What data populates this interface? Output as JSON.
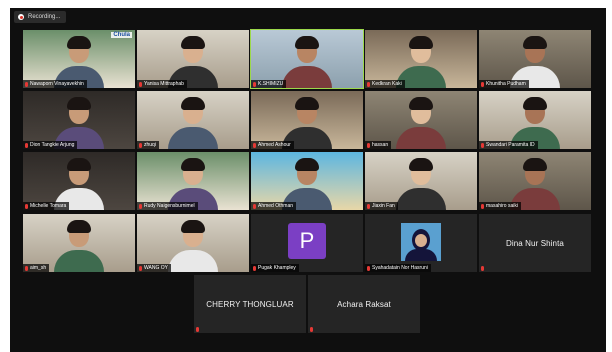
{
  "recording_label": "Recording...",
  "tiles": [
    {
      "id": "t1",
      "name": "Nawaporn Vinayavekhin",
      "style": "room"
    },
    {
      "id": "t2",
      "name": "Yanisa Mittraphab",
      "style": "wall"
    },
    {
      "id": "t3",
      "name": "K.SHIMIZU",
      "style": "office",
      "speaking": true
    },
    {
      "id": "t4",
      "name": "Kedkran Kaki",
      "style": "home"
    },
    {
      "id": "t5",
      "name": "Khunitha Pudham",
      "style": "room2"
    },
    {
      "id": "t6",
      "name": "Dion Tangkie Arjung",
      "style": "dark"
    },
    {
      "id": "t7",
      "name": "zhuqi",
      "style": "wall"
    },
    {
      "id": "t8",
      "name": "Ahmed Ashour",
      "style": "home"
    },
    {
      "id": "t9",
      "name": "hassan",
      "style": "room2"
    },
    {
      "id": "t10",
      "name": "Swandari Paramita ID",
      "style": "wall"
    },
    {
      "id": "t11",
      "name": "Michelle Tomara",
      "style": "dark"
    },
    {
      "id": "t12",
      "name": "Rudy Naigensburnimel",
      "style": "room"
    },
    {
      "id": "t13",
      "name": "Ahmed Othman",
      "style": "beach"
    },
    {
      "id": "t14",
      "name": "Jiaxin Fan",
      "style": "wall"
    },
    {
      "id": "t15",
      "name": "masahiro saiki",
      "style": "room2"
    },
    {
      "id": "t16",
      "name": "aim_sh",
      "style": "wall"
    },
    {
      "id": "t17",
      "name": "WANG OY",
      "style": "wall"
    },
    {
      "id": "t18",
      "name": "Pugak Khampley",
      "style": "avatar",
      "avatar_letter": "P"
    },
    {
      "id": "t19",
      "name": "Syahadatain Nor Hasruni",
      "style": "photo"
    },
    {
      "id": "t20",
      "name": "",
      "style": "name",
      "center_name": "Dina Nur Shinta"
    },
    {
      "id": "t21",
      "name": "",
      "style": "name",
      "center_name": "CHERRY THONGLUAR"
    },
    {
      "id": "t22",
      "name": "",
      "style": "name",
      "center_name": "Achara Raksat"
    }
  ],
  "logo_text": "Chula",
  "colors": {
    "background": "#0f0f0f",
    "tile_off": "#252525",
    "active_speaker": "#9cd94b",
    "mic_muted": "#e53935",
    "avatar": "#7b3fc4"
  }
}
